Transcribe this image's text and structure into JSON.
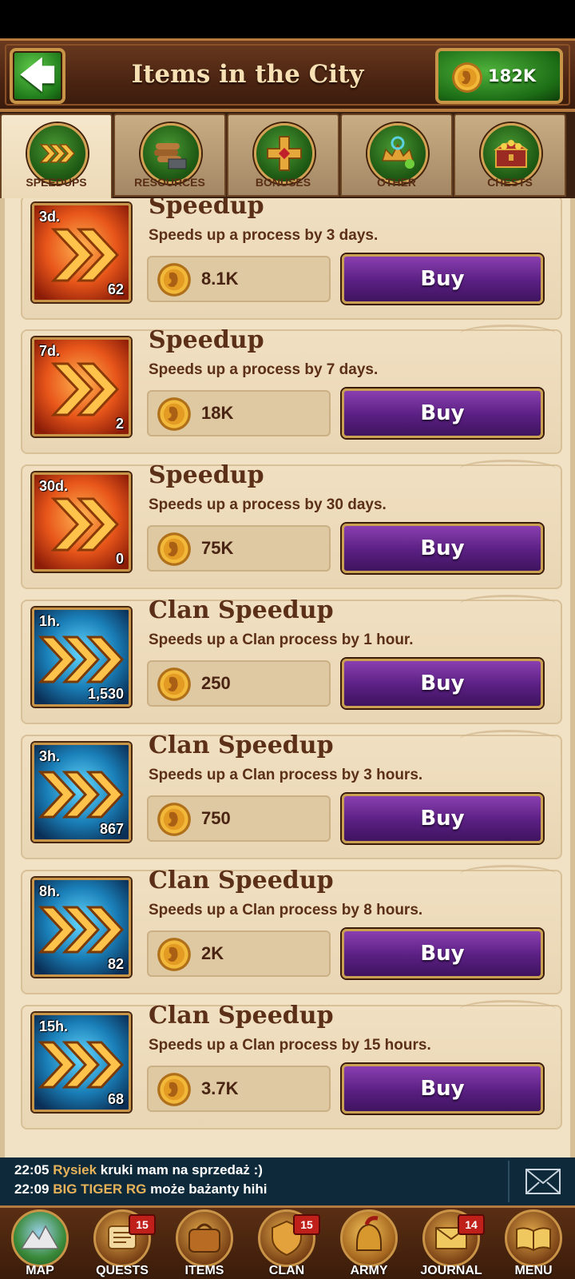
{
  "header": {
    "title": "Items in the City",
    "gold": "182K"
  },
  "tabs": [
    {
      "label": "SPEEDUPS",
      "icon": "speedups-icon",
      "active": true
    },
    {
      "label": "RESOURCES",
      "icon": "resources-icon",
      "active": false
    },
    {
      "label": "BONUSES",
      "icon": "bonuses-icon",
      "active": false
    },
    {
      "label": "OTHER",
      "icon": "other-icon",
      "active": false
    },
    {
      "label": "CHESTS",
      "icon": "chests-icon",
      "active": false
    }
  ],
  "items": [
    {
      "name": "Speedup",
      "desc": "Speeds up a process by 3 days.",
      "duration": "3d.",
      "count": "62",
      "price": "8.1K",
      "buy_label": "Buy",
      "theme": "orange"
    },
    {
      "name": "Speedup",
      "desc": "Speeds up a process by 7 days.",
      "duration": "7d.",
      "count": "2",
      "price": "18K",
      "buy_label": "Buy",
      "theme": "orange"
    },
    {
      "name": "Speedup",
      "desc": "Speeds up a process by 30 days.",
      "duration": "30d.",
      "count": "0",
      "price": "75K",
      "buy_label": "Buy",
      "theme": "orange"
    },
    {
      "name": "Clan Speedup",
      "desc": "Speeds up a Clan process by 1 hour.",
      "duration": "1h.",
      "count": "1,530",
      "price": "250",
      "buy_label": "Buy",
      "theme": "blue"
    },
    {
      "name": "Clan Speedup",
      "desc": "Speeds up a Clan process by 3 hours.",
      "duration": "3h.",
      "count": "867",
      "price": "750",
      "buy_label": "Buy",
      "theme": "blue"
    },
    {
      "name": "Clan Speedup",
      "desc": "Speeds up a Clan process by 8 hours.",
      "duration": "8h.",
      "count": "82",
      "price": "2K",
      "buy_label": "Buy",
      "theme": "blue"
    },
    {
      "name": "Clan Speedup",
      "desc": "Speeds up a Clan process by 15 hours.",
      "duration": "15h.",
      "count": "68",
      "price": "3.7K",
      "buy_label": "Buy",
      "theme": "blue"
    }
  ],
  "chat": [
    {
      "time": "22:05",
      "user": "Rysiek",
      "text": "kruki mam na sprzedaż :)"
    },
    {
      "time": "22:09",
      "user": "BIG TIGER RG",
      "text": "może bażanty hihi"
    }
  ],
  "nav": [
    {
      "label": "MAP",
      "icon": "map-icon",
      "badge": ""
    },
    {
      "label": "QUESTS",
      "icon": "quests-icon",
      "badge": "15"
    },
    {
      "label": "ITEMS",
      "icon": "items-icon",
      "badge": ""
    },
    {
      "label": "CLAN",
      "icon": "clan-icon",
      "badge": "15"
    },
    {
      "label": "ARMY",
      "icon": "army-icon",
      "badge": ""
    },
    {
      "label": "JOURNAL",
      "icon": "journal-icon",
      "badge": "14"
    },
    {
      "label": "MENU",
      "icon": "menu-icon",
      "badge": ""
    }
  ]
}
